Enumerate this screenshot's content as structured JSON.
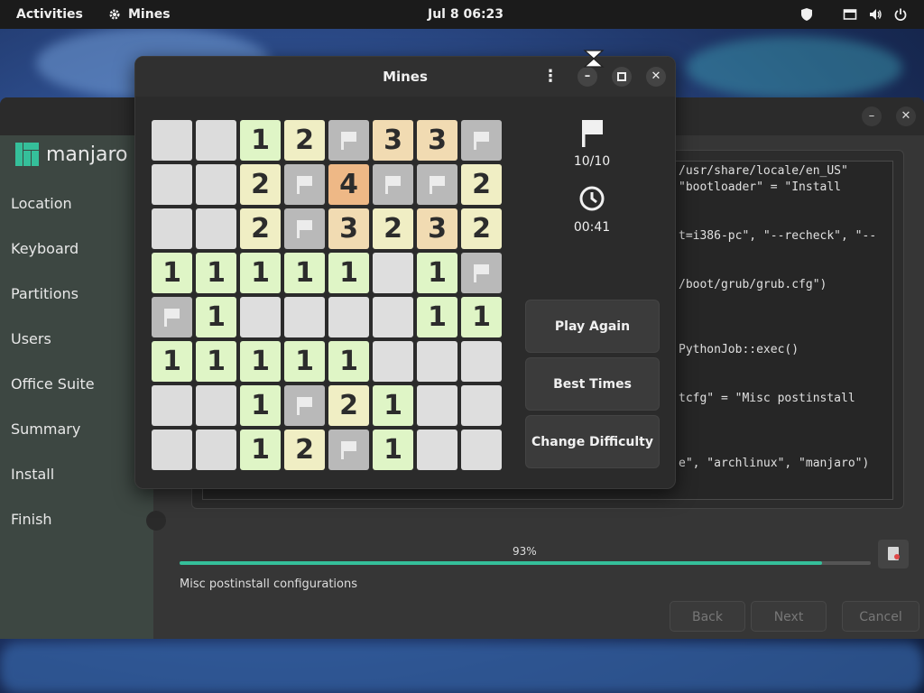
{
  "topbar": {
    "activities": "Activities",
    "app_name": "Mines",
    "clock": "Jul 8  06:23"
  },
  "installer": {
    "logo_text": "manjaro",
    "sidebar": [
      "Location",
      "Keyboard",
      "Partitions",
      "Users",
      "Office Suite",
      "Summary",
      "Install",
      "Finish"
    ],
    "log_lines": [
      "/usr/share/locale/en_US\"",
      "\"bootloader\" = \"Install",
      "t=i386-pc\", \"--recheck\", \"--",
      "/boot/grub/grub.cfg\")",
      "PythonJob::exec()",
      "tcfg\" = \"Misc postinstall",
      "e\", \"archlinux\", \"manjaro\")"
    ],
    "progress_percent": 93,
    "progress_label": "93%",
    "status": "Misc postinstall configurations",
    "buttons": {
      "back": "Back",
      "next": "Next",
      "cancel": "Cancel"
    }
  },
  "mines": {
    "title": "Mines",
    "flags": "10/10",
    "time": "00:41",
    "buttons": {
      "play_again": "Play Again",
      "best_times": "Best Times",
      "change_difficulty": "Change Difficulty"
    },
    "board": [
      [
        "U",
        "U",
        "1",
        "2",
        "F",
        "3",
        "3",
        "F"
      ],
      [
        "U",
        "U",
        "2",
        "F",
        "4",
        "F",
        "F",
        "2"
      ],
      [
        "U",
        "U",
        "2",
        "F",
        "3",
        "2",
        "3",
        "2"
      ],
      [
        "1",
        "1",
        "1",
        "1",
        "1",
        "E",
        "1",
        "F"
      ],
      [
        "F",
        "1",
        "E",
        "E",
        "E",
        "E",
        "1",
        "1"
      ],
      [
        "1",
        "1",
        "1",
        "1",
        "1",
        "E",
        "E",
        "E"
      ],
      [
        "U",
        "U",
        "1",
        "F",
        "2",
        "1",
        "E",
        "E"
      ],
      [
        "U",
        "U",
        "1",
        "2",
        "F",
        "1",
        "E",
        "E"
      ]
    ]
  },
  "colors": {
    "accent": "#35bf9a",
    "manjaro_green": "#35bf9a"
  }
}
